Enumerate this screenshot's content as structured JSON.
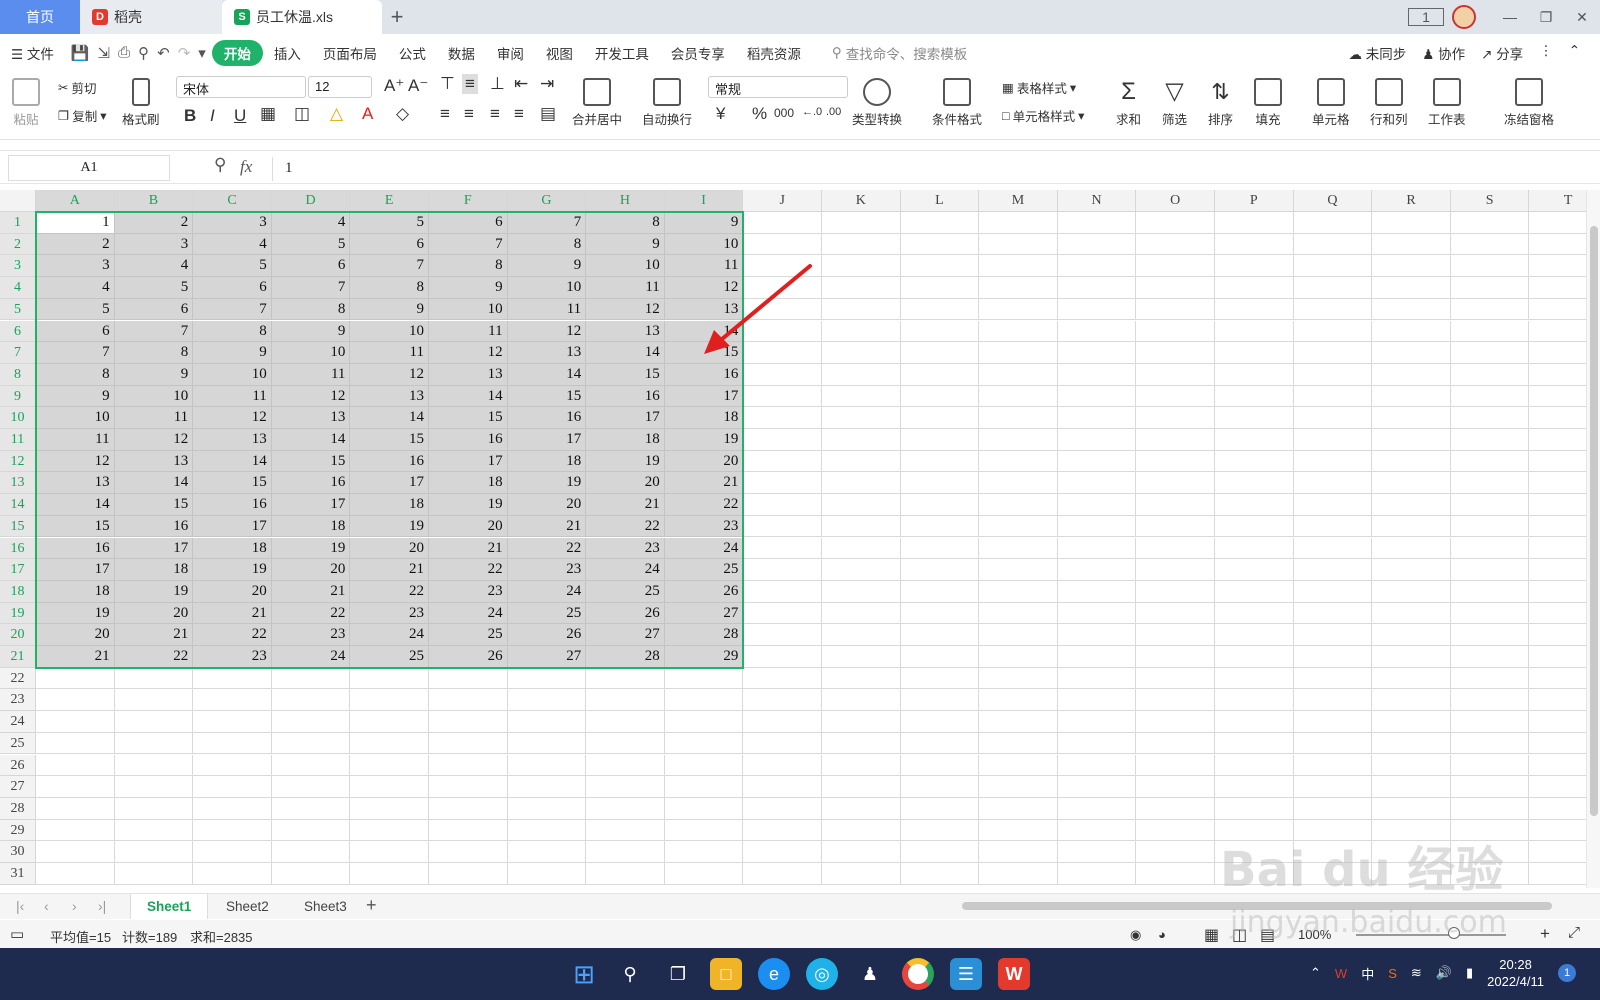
{
  "tabs": {
    "home": "首页",
    "doc1": "稻壳",
    "doc2": "员工休温.xls",
    "add": "+"
  },
  "window": {
    "badge": "1"
  },
  "menu": {
    "file": "文件",
    "items": [
      "开始",
      "插入",
      "页面布局",
      "公式",
      "数据",
      "审阅",
      "视图",
      "开发工具",
      "会员专享",
      "稻壳资源"
    ],
    "search_placeholder": "查找命令、搜索模板",
    "sync": "未同步",
    "collab": "协作",
    "share": "分享"
  },
  "ribbon": {
    "paste": "粘贴",
    "cut": "剪切",
    "copy": "复制",
    "format_painter": "格式刷",
    "font_name": "宋体",
    "font_size": "12",
    "merge_center": "合并居中",
    "wrap_text": "自动换行",
    "number_format": "常规",
    "type_convert": "类型转换",
    "cond_format": "条件格式",
    "table_style": "表格样式",
    "cell_style": "单元格样式",
    "sum": "求和",
    "filter": "筛选",
    "sort": "排序",
    "fill": "填充",
    "cell": "单元格",
    "rowcol": "行和列",
    "worksheet": "工作表",
    "freeze": "冻结窗格"
  },
  "formula": {
    "name_box": "A1",
    "fx": "fx",
    "value": "1"
  },
  "columns": [
    "A",
    "B",
    "C",
    "D",
    "E",
    "F",
    "G",
    "H",
    "I",
    "J",
    "K",
    "L",
    "M",
    "N",
    "O",
    "P",
    "Q",
    "R",
    "S",
    "T"
  ],
  "rows": [
    "1",
    "2",
    "3",
    "4",
    "5",
    "6",
    "7",
    "8",
    "9",
    "10",
    "11",
    "12",
    "13",
    "14",
    "15",
    "16",
    "17",
    "18",
    "19",
    "20",
    "21",
    "22",
    "23",
    "24",
    "25",
    "26",
    "27",
    "28",
    "29",
    "30",
    "31"
  ],
  "cells": [
    [
      1,
      2,
      3,
      4,
      5,
      6,
      7,
      8,
      9
    ],
    [
      2,
      3,
      4,
      5,
      6,
      7,
      8,
      9,
      10
    ],
    [
      3,
      4,
      5,
      6,
      7,
      8,
      9,
      10,
      11
    ],
    [
      4,
      5,
      6,
      7,
      8,
      9,
      10,
      11,
      12
    ],
    [
      5,
      6,
      7,
      8,
      9,
      10,
      11,
      12,
      13
    ],
    [
      6,
      7,
      8,
      9,
      10,
      11,
      12,
      13,
      14
    ],
    [
      7,
      8,
      9,
      10,
      11,
      12,
      13,
      14,
      15
    ],
    [
      8,
      9,
      10,
      11,
      12,
      13,
      14,
      15,
      16
    ],
    [
      9,
      10,
      11,
      12,
      13,
      14,
      15,
      16,
      17
    ],
    [
      10,
      11,
      12,
      13,
      14,
      15,
      16,
      17,
      18
    ],
    [
      11,
      12,
      13,
      14,
      15,
      16,
      17,
      18,
      19
    ],
    [
      12,
      13,
      14,
      15,
      16,
      17,
      18,
      19,
      20
    ],
    [
      13,
      14,
      15,
      16,
      17,
      18,
      19,
      20,
      21
    ],
    [
      14,
      15,
      16,
      17,
      18,
      19,
      20,
      21,
      22
    ],
    [
      15,
      16,
      17,
      18,
      19,
      20,
      21,
      22,
      23
    ],
    [
      16,
      17,
      18,
      19,
      20,
      21,
      22,
      23,
      24
    ],
    [
      17,
      18,
      19,
      20,
      21,
      22,
      23,
      24,
      25
    ],
    [
      18,
      19,
      20,
      21,
      22,
      23,
      24,
      25,
      26
    ],
    [
      19,
      20,
      21,
      22,
      23,
      24,
      25,
      26,
      27
    ],
    [
      20,
      21,
      22,
      23,
      24,
      25,
      26,
      27,
      28
    ],
    [
      21,
      22,
      23,
      24,
      25,
      26,
      27,
      28,
      29
    ]
  ],
  "sheets": [
    "Sheet1",
    "Sheet2",
    "Sheet3"
  ],
  "status": {
    "average": "平均值=15",
    "count": "计数=189",
    "sum": "求和=2835",
    "zoom": "100%"
  },
  "taskbar": {
    "ime": "中",
    "time": "20:28",
    "date": "2022/4/11",
    "notif": "1"
  },
  "watermark": {
    "line1": "Bai du 经验",
    "line2": "jingyan.baidu.com"
  },
  "colors": {
    "accent": "#1fb26b",
    "selection_fill": "#d6d6d6",
    "arrow": "#e0201e"
  }
}
